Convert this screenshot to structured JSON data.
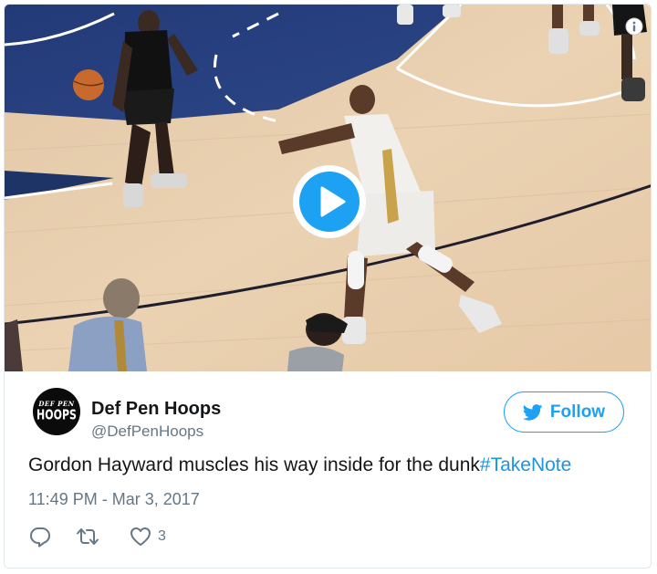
{
  "media": {
    "type": "video",
    "play_icon": "play-icon",
    "info_icon": "info-icon"
  },
  "tweet": {
    "display_name": "Def Pen Hoops",
    "handle": "@DefPenHoops",
    "avatar": {
      "small_text": "DEF PEN",
      "big_text": "HOOPS"
    },
    "follow_label": "Follow",
    "text": "Gordon Hayward muscles his way inside for the dunk",
    "hashtag": "#TakeNote",
    "timestamp": "11:49 PM - Mar 3, 2017",
    "like_count": "3"
  },
  "colors": {
    "brand_blue": "#1da1f2",
    "link_blue": "#1b95e0",
    "muted_gray": "#657786",
    "text_dark": "#14171a",
    "border": "#e1e8ed"
  },
  "icons": [
    "twitter-bird-icon",
    "reply-icon",
    "retweet-icon",
    "heart-icon"
  ]
}
